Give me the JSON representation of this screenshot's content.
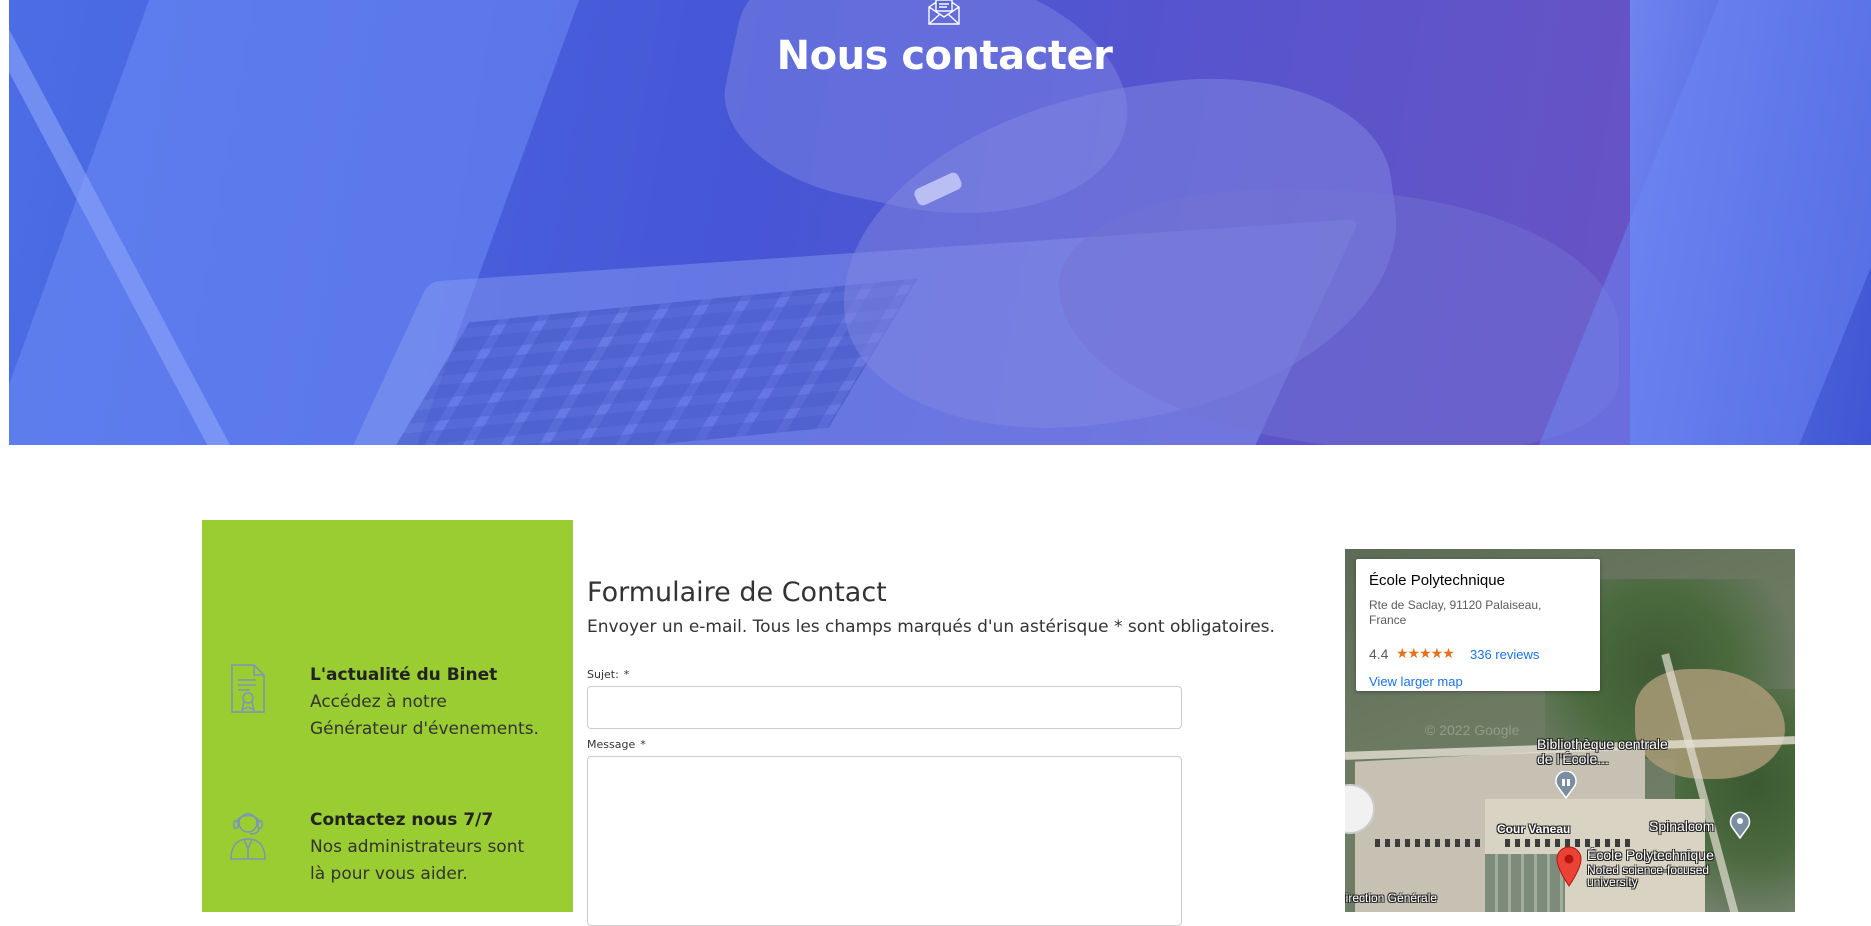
{
  "hero": {
    "title": "Nous contacter",
    "icon": "envelope-letter-icon",
    "colors": {
      "overlay": "#4a5ad8"
    }
  },
  "info_panel": {
    "background": "#9acd32",
    "items": [
      {
        "icon": "certificate-document-icon",
        "title": "L'actualité du Binet",
        "description": "Accédez à notre Générateur d'évenements."
      },
      {
        "icon": "support-agent-icon",
        "title": "Contactez nous 7/7",
        "description": "Nos administrateurs sont là pour vous aider."
      }
    ]
  },
  "form": {
    "title": "Formulaire de Contact",
    "subtitle": "Envoyer un e-mail. Tous les champs marqués d'un astérisque * sont obligatoires.",
    "fields": [
      {
        "label": "Sujet:",
        "required_mark": "*",
        "value": ""
      },
      {
        "label": "Message",
        "required_mark": "*",
        "value": ""
      }
    ]
  },
  "map": {
    "card": {
      "name": "École Polytechnique",
      "address": "Rte de Saclay, 91120 Palaiseau, France",
      "rating": "4.4",
      "stars": "★★★★★",
      "reviews": "336 reviews",
      "larger_map": "View larger map"
    },
    "copyright": "© 2022 Google",
    "labels": {
      "library": "Bibliothèque centrale de l'École...",
      "cour": "Cour Vaneau",
      "spinalcom": "Spinalcom",
      "place_name": "École Polytechnique",
      "place_desc": "Noted science-focused university",
      "direction": "Direction Générale"
    }
  }
}
